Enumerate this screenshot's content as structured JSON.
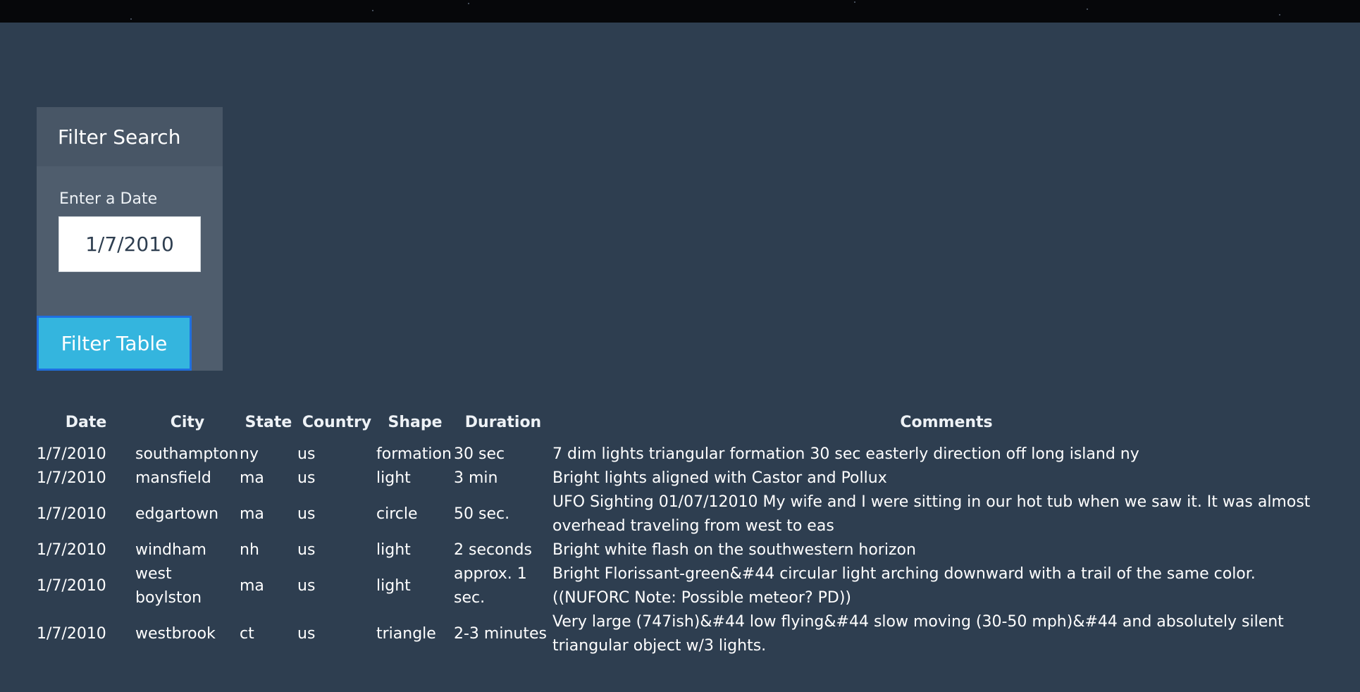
{
  "panel": {
    "title": "Filter Search",
    "date_label": "Enter a Date",
    "date_value": "1/7/2010",
    "button_label": "Filter Table"
  },
  "table": {
    "headers": [
      "Date",
      "City",
      "State",
      "Country",
      "Shape",
      "Duration",
      "Comments"
    ],
    "rows": [
      [
        "1/7/2010",
        "southampton",
        "ny",
        "us",
        "formation",
        "30 sec",
        "7 dim lights triangular formation 30 sec easterly direction off long island ny"
      ],
      [
        "1/7/2010",
        "mansfield",
        "ma",
        "us",
        "light",
        "3 min",
        "Bright lights aligned with Castor and Pollux"
      ],
      [
        "1/7/2010",
        "edgartown",
        "ma",
        "us",
        "circle",
        "50 sec.",
        "UFO Sighting 01/07/12010 My wife and I were sitting in our hot tub when we saw it. It was almost overhead traveling from west to eas"
      ],
      [
        "1/7/2010",
        "windham",
        "nh",
        "us",
        "light",
        "2 seconds",
        "Bright white flash on the southwestern horizon"
      ],
      [
        "1/7/2010",
        "west boylston",
        "ma",
        "us",
        "light",
        "approx. 1 sec.",
        "Bright Florissant-green&#44 circular light arching downward with a trail of the same color. ((NUFORC Note: Possible meteor? PD))"
      ],
      [
        "1/7/2010",
        "westbrook",
        "ct",
        "us",
        "triangle",
        "2-3 minutes",
        "Very large (747ish)&#44 low flying&#44 slow moving (30-50 mph)&#44 and absolutely silent triangular object w/3 lights."
      ]
    ]
  }
}
